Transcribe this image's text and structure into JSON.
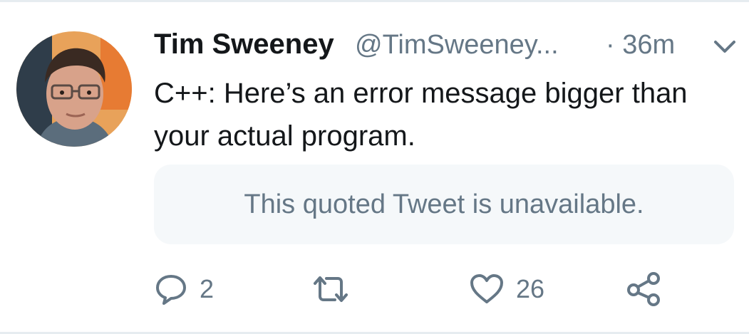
{
  "tweet": {
    "author_name": "Tim Sweeney",
    "author_handle": "@TimSweeney...",
    "time": "· 36m",
    "text": "C++: Here’s an error message bigger than your actual program.",
    "quoted_notice": "This quoted Tweet is unavailable.",
    "actions": {
      "reply_count": "2",
      "like_count": "26"
    }
  },
  "icons": {
    "caret": "chevron-down-icon",
    "reply": "reply-icon",
    "retweet": "retweet-icon",
    "like": "heart-icon",
    "share": "share-icon"
  },
  "colors": {
    "text_primary": "#14171a",
    "text_secondary": "#657786",
    "quoted_bg": "#f5f8fa",
    "border": "#e6ecf0"
  }
}
